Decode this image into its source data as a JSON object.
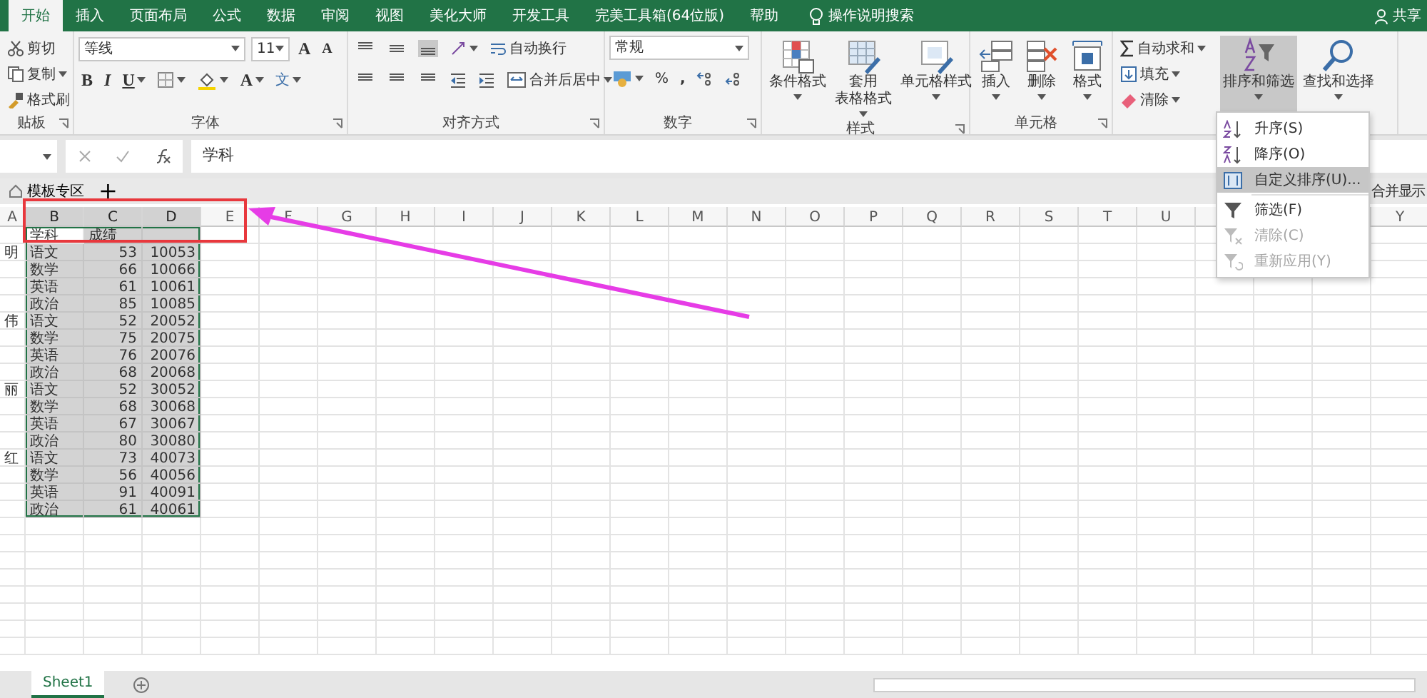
{
  "tabs": [
    {
      "label": "开始",
      "selected": true
    },
    {
      "label": "插入",
      "selected": false
    },
    {
      "label": "页面布局",
      "selected": false
    },
    {
      "label": "公式",
      "selected": false
    },
    {
      "label": "数据",
      "selected": false
    },
    {
      "label": "审阅",
      "selected": false
    },
    {
      "label": "视图",
      "selected": false
    },
    {
      "label": "美化大师",
      "selected": false
    },
    {
      "label": "开发工具",
      "selected": false
    },
    {
      "label": "完美工具箱(64位版)",
      "selected": false
    },
    {
      "label": "帮助",
      "selected": false
    }
  ],
  "tell_me": "操作说明搜索",
  "share": "共享",
  "ribbon": {
    "clipboard": {
      "label": "贴板",
      "buttons": [
        "剪切",
        "复制",
        "格式刷"
      ]
    },
    "font": {
      "label": "字体",
      "font_name": "等线",
      "font_size": "11",
      "grow": "A",
      "shrink": "A",
      "bold": "B",
      "italic": "I",
      "underline": "U",
      "font_color": "A",
      "phonetic": "文"
    },
    "alignment": {
      "label": "对齐方式",
      "wrap": "自动换行",
      "merge": "合并后居中"
    },
    "number": {
      "label": "数字",
      "format": "常规",
      "percent": "%",
      "comma": ","
    },
    "styles": {
      "label": "样式",
      "buttons": [
        [
          "条件格式"
        ],
        [
          "套用",
          "表格格式"
        ],
        [
          "单元格样式"
        ]
      ]
    },
    "cells": {
      "label": "单元格",
      "buttons": [
        "插入",
        "删除",
        "格式"
      ]
    },
    "editing": {
      "small_buttons": [
        "自动求和",
        "填充",
        "清除"
      ],
      "large_buttons": [
        {
          "label": "排序和筛选",
          "selected": true
        },
        {
          "label": "查找和选择",
          "selected": false
        }
      ]
    }
  },
  "formula_bar": {
    "formula": "学科"
  },
  "template_bar": {
    "tab": "模板专区",
    "add": "+",
    "note": "合并显示"
  },
  "sheet": {
    "columns": [
      {
        "label": "A",
        "selected": false
      },
      {
        "label": "B",
        "selected": true
      },
      {
        "label": "C",
        "selected": true,
        "numeric": true
      },
      {
        "label": "D",
        "selected": true,
        "numeric": true
      },
      {
        "label": "E",
        "selected": false
      },
      {
        "label": "F",
        "selected": false
      },
      {
        "label": "G",
        "selected": false
      },
      {
        "label": "H",
        "selected": false
      },
      {
        "label": "I",
        "selected": false
      },
      {
        "label": "J",
        "selected": false
      },
      {
        "label": "K",
        "selected": false
      },
      {
        "label": "L",
        "selected": false
      },
      {
        "label": "M",
        "selected": false
      },
      {
        "label": "N",
        "selected": false
      },
      {
        "label": "O",
        "selected": false
      },
      {
        "label": "P",
        "selected": false
      },
      {
        "label": "Q",
        "selected": false
      },
      {
        "label": "R",
        "selected": false
      },
      {
        "label": "S",
        "selected": false
      },
      {
        "label": "T",
        "selected": false
      },
      {
        "label": "U",
        "selected": false
      },
      {
        "selected": false
      },
      {},
      {},
      {
        "label": "Y",
        "selected": false
      }
    ],
    "rows": [
      {
        "cells": [
          "",
          "学科",
          "成绩",
          ""
        ],
        "selected": true,
        "active": true,
        "kind": "header"
      },
      {
        "cells": [
          "明",
          "语文",
          "53",
          "10053"
        ],
        "selected": true,
        "active": false
      },
      {
        "cells": [
          "",
          "数学",
          "66",
          "10066"
        ],
        "selected": true,
        "active": false
      },
      {
        "cells": [
          "",
          "英语",
          "61",
          "10061"
        ],
        "selected": true,
        "active": false
      },
      {
        "cells": [
          "",
          "政治",
          "85",
          "10085"
        ],
        "selected": true,
        "active": false
      },
      {
        "cells": [
          "伟",
          "语文",
          "52",
          "20052"
        ],
        "selected": true,
        "active": false
      },
      {
        "cells": [
          "",
          "数学",
          "75",
          "20075"
        ],
        "selected": true,
        "active": false
      },
      {
        "cells": [
          "",
          "英语",
          "76",
          "20076"
        ],
        "selected": true,
        "active": false
      },
      {
        "cells": [
          "",
          "政治",
          "68",
          "20068"
        ],
        "selected": true,
        "active": false
      },
      {
        "cells": [
          "丽",
          "语文",
          "52",
          "30052"
        ],
        "selected": true,
        "active": false
      },
      {
        "cells": [
          "",
          "数学",
          "68",
          "30068"
        ],
        "selected": true,
        "active": false
      },
      {
        "cells": [
          "",
          "英语",
          "67",
          "30067"
        ],
        "selected": true,
        "active": false
      },
      {
        "cells": [
          "",
          "政治",
          "80",
          "30080"
        ],
        "selected": true,
        "active": false
      },
      {
        "cells": [
          "红",
          "语文",
          "73",
          "40073"
        ],
        "selected": true,
        "active": false
      },
      {
        "cells": [
          "",
          "数学",
          "56",
          "40056"
        ],
        "selected": true,
        "active": false
      },
      {
        "cells": [
          "",
          "英语",
          "91",
          "40091"
        ],
        "selected": true,
        "active": false
      },
      {
        "cells": [
          "",
          "政治",
          "61",
          "40061"
        ],
        "selected": true,
        "active": false
      }
    ]
  },
  "sort_menu": [
    {
      "label": "升序(S)",
      "disabled": false,
      "selected": false
    },
    {
      "label": "降序(O)",
      "disabled": false,
      "selected": false
    },
    {
      "label": "自定义排序(U)...",
      "disabled": false,
      "selected": true
    },
    {
      "label": "筛选(F)",
      "disabled": false,
      "selected": false
    },
    {
      "label": "清除(C)",
      "disabled": true,
      "selected": false
    },
    {
      "label": "重新应用(Y)",
      "disabled": true,
      "selected": false
    }
  ],
  "sheet_tabs": [
    {
      "label": "Sheet1",
      "selected": true
    }
  ],
  "annotations": [
    {
      "kind": "box",
      "color": "#e8383d"
    },
    {
      "kind": "arrow",
      "color": "#e63ce6"
    }
  ]
}
